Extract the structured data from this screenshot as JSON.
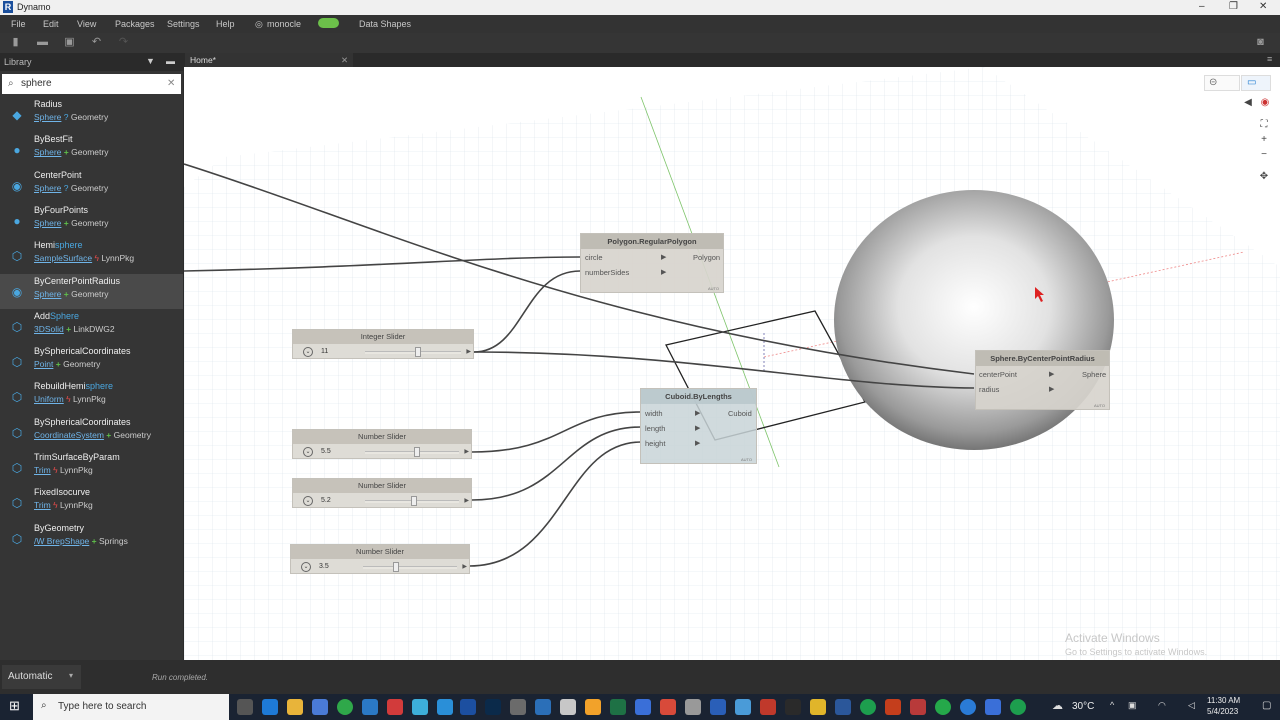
{
  "window": {
    "title": "Dynamo"
  },
  "menu": [
    "File",
    "Edit",
    "View",
    "Packages",
    "Settings",
    "Help",
    "monocle",
    "Data Shapes"
  ],
  "library": {
    "title": "Library",
    "search_value": "sphere",
    "items": [
      {
        "name_pre": "Radius",
        "name_hl": "",
        "name_post": "",
        "category": "Sphere",
        "sep": "?",
        "pkg": "Geometry",
        "sel": false
      },
      {
        "name_pre": "ByBestFit",
        "name_hl": "",
        "name_post": "",
        "category": "Sphere",
        "sep": "+",
        "pkg": "Geometry",
        "sel": false
      },
      {
        "name_pre": "CenterPoint",
        "name_hl": "",
        "name_post": "",
        "category": "Sphere",
        "sep": "?",
        "pkg": "Geometry",
        "sel": false
      },
      {
        "name_pre": "ByFourPoints",
        "name_hl": "",
        "name_post": "",
        "category": "Sphere",
        "sep": "+",
        "pkg": "Geometry",
        "sel": false
      },
      {
        "name_pre": "Hemi",
        "name_hl": "sphere",
        "name_post": "",
        "category": "SampleSurface",
        "sep": "bolt",
        "pkg": "LynnPkg",
        "sel": false
      },
      {
        "name_pre": "ByCenterPointRadius",
        "name_hl": "",
        "name_post": "",
        "category": "Sphere",
        "sep": "+",
        "pkg": "Geometry",
        "sel": true
      },
      {
        "name_pre": "Add",
        "name_hl": "Sphere",
        "name_post": "",
        "category": "3DSolid",
        "sep": "+",
        "pkg": "LinkDWG2",
        "sel": false
      },
      {
        "name_pre": "BySphericalCoordinates",
        "name_hl": "",
        "name_post": "",
        "category": "Point",
        "sep": "+",
        "pkg": "Geometry",
        "sel": false
      },
      {
        "name_pre": "RebuildHemi",
        "name_hl": "sphere",
        "name_post": "",
        "category": "Uniform",
        "sep": "bolt",
        "pkg": "LynnPkg",
        "sel": false
      },
      {
        "name_pre": "BySphericalCoordinates",
        "name_hl": "",
        "name_post": "",
        "category": "CoordinateSystem",
        "sep": "+",
        "pkg": "Geometry",
        "sel": false
      },
      {
        "name_pre": "TrimSurfaceByParam",
        "name_hl": "",
        "name_post": "",
        "category": "Trim",
        "sep": "bolt",
        "pkg": "LynnPkg",
        "sel": false
      },
      {
        "name_pre": "FixedIsocurve",
        "name_hl": "",
        "name_post": "",
        "category": "Trim",
        "sep": "bolt",
        "pkg": "LynnPkg",
        "sel": false
      },
      {
        "name_pre": "ByGeometry",
        "name_hl": "",
        "name_post": "",
        "category": "/W BrepShape",
        "sep": "+",
        "pkg": "Springs",
        "sel": false
      }
    ]
  },
  "tab": {
    "label": "Home*"
  },
  "nodes": {
    "polygon": {
      "title": "Polygon.RegularPolygon",
      "in1": "circle",
      "in2": "numberSides",
      "out": "Polygon",
      "auto": "AUTO"
    },
    "cuboid": {
      "title": "Cuboid.ByLengths",
      "in1": "width",
      "in2": "length",
      "in3": "height",
      "out": "Cuboid",
      "auto": "AUTO"
    },
    "sphere": {
      "title": "Sphere.ByCenterPointRadius",
      "in1": "centerPoint",
      "in2": "radius",
      "out": "Sphere",
      "auto": "AUTO"
    }
  },
  "sliders": [
    {
      "title": "Integer Slider",
      "value": "11",
      "fraction": 0.55
    },
    {
      "title": "Number Slider",
      "value": "5.5",
      "fraction": 0.55
    },
    {
      "title": "Number Slider",
      "value": "5.2",
      "fraction": 0.52
    },
    {
      "title": "Number Slider",
      "value": "3.5",
      "fraction": 0.35
    }
  ],
  "watermark": {
    "line1": "Activate Windows",
    "line2": "Go to Settings to activate Windows."
  },
  "status": {
    "run_mode": "Automatic",
    "run_status": "Run completed."
  },
  "taskbar": {
    "search_placeholder": "Type here to search",
    "weather": "30°C",
    "time": "11:30 AM",
    "date": "5/4/2023"
  },
  "colors": {
    "accent": "#4aa7e0",
    "package_plus": "#5fbf4a",
    "bolt": "#e24b4b"
  }
}
